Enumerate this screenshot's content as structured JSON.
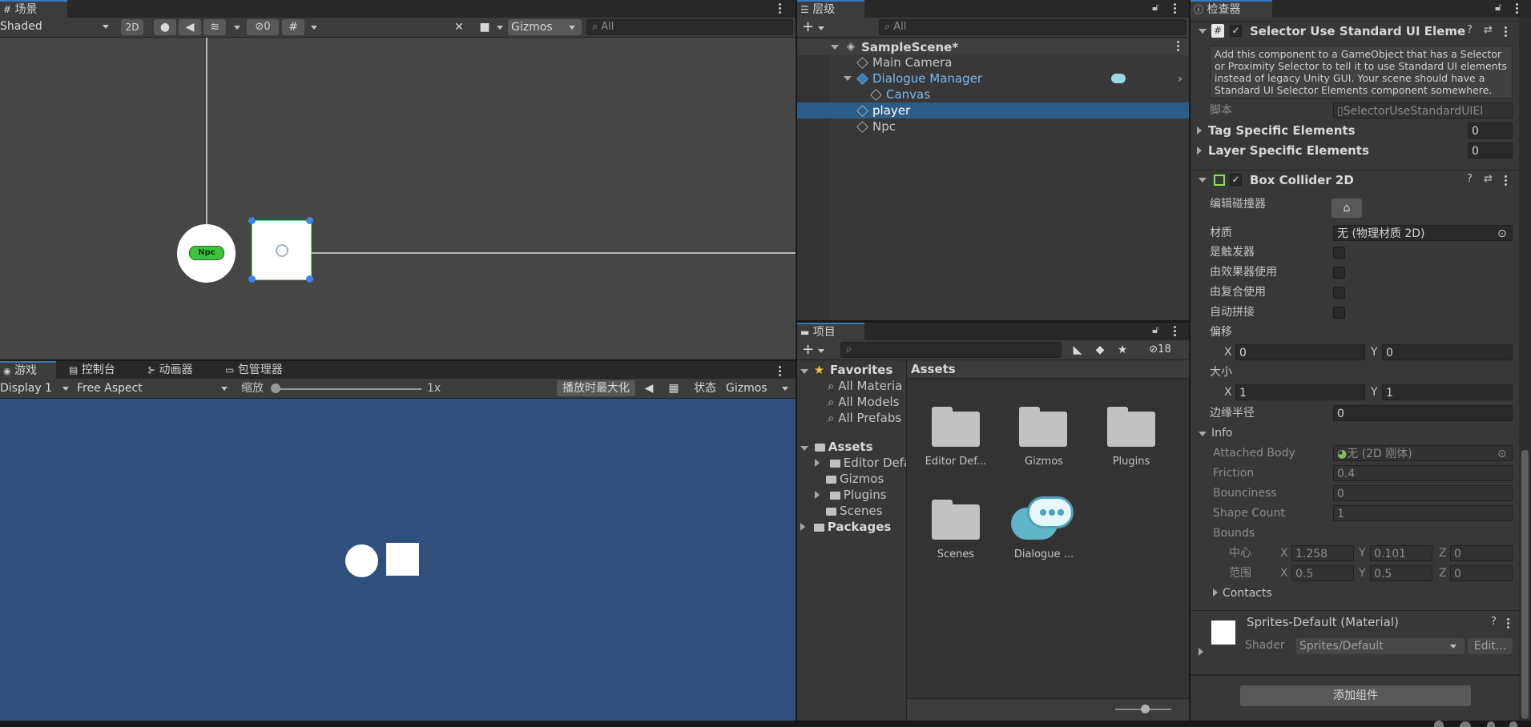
{
  "scene": {
    "tab": "场景",
    "shading": "Shaded",
    "mode2d": "2D",
    "hidden_count": "0",
    "gizmos": "Gizmos",
    "search_placeholder": "All",
    "npc_label": "Npc"
  },
  "game": {
    "tabs": [
      "游戏",
      "控制台",
      "动画器",
      "包管理器"
    ],
    "display": "Display 1",
    "aspect": "Free Aspect",
    "scale_label": "缩放",
    "scale_value": "1x",
    "maximize": "播放时最大化",
    "stats": "状态",
    "gizmos": "Gizmos",
    "background": "#2f4f7c"
  },
  "hierarchy": {
    "tab": "层级",
    "search_placeholder": "All",
    "scene_name": "SampleScene*",
    "items": [
      "Main Camera",
      "Dialogue Manager",
      "Canvas",
      "player",
      "Npc"
    ]
  },
  "project": {
    "tab": "项目",
    "badge_count": "18",
    "favorites": "Favorites",
    "fav_items": [
      "All Materia",
      "All Models",
      "All Prefabs"
    ],
    "assets_root": "Assets",
    "asset_folders": [
      "Editor Defa",
      "Gizmos",
      "Plugins",
      "Scenes"
    ],
    "packages": "Packages",
    "breadcrumb": "Assets",
    "grid": [
      "Editor Def...",
      "Gizmos",
      "Plugins",
      "Scenes",
      "Dialogue ..."
    ]
  },
  "inspector": {
    "tab": "检查器",
    "comp1_title": "Selector Use Standard UI Element",
    "comp1_help": "Add this component to a GameObject that has a Selector or Proximity Selector to tell it to use Standard UI elements instead of legacy Unity GUI. Your scene should have a Standard UI Selector Elements component somewhere.",
    "script_label": "脚本",
    "script_value": "SelectorUseStandardUIEl",
    "tag_label": "Tag Specific Elements",
    "tag_value": "0",
    "layer_label": "Layer Specific Elements",
    "layer_value": "0",
    "comp2_title": "Box Collider 2D",
    "edit_collider": "编辑碰撞器",
    "material_label": "材质",
    "material_value": "无 (物理材质 2D)",
    "is_trigger": "是触发器",
    "used_by_effector": "由效果器使用",
    "used_by_composite": "由复合使用",
    "auto_tiling": "自动拼接",
    "offset_label": "偏移",
    "offset_x": "0",
    "offset_y": "0",
    "size_label": "大小",
    "size_x": "1",
    "size_y": "1",
    "edge_radius_label": "边缘半径",
    "edge_radius": "0",
    "info_label": "Info",
    "attached_body_label": "Attached Body",
    "attached_body_value": "无 (2D 刚体)",
    "friction_label": "Friction",
    "friction": "0.4",
    "bounciness_label": "Bounciness",
    "bounciness": "0",
    "shape_count_label": "Shape Count",
    "shape_count": "1",
    "bounds_label": "Bounds",
    "center_label": "中心",
    "center_x": "1.258",
    "center_y": "0.101",
    "center_z": "0",
    "extent_label": "范围",
    "extent_x": "0.5",
    "extent_y": "0.5",
    "extent_z": "0",
    "contacts_label": "Contacts",
    "material_name": "Sprites-Default (Material)",
    "shader_label": "Shader",
    "shader_value": "Sprites/Default",
    "edit_label": "Edit...",
    "add_component": "添加组件",
    "axis_x": "X",
    "axis_y": "Y",
    "axis_z": "Z"
  },
  "colors": {
    "accent": "#3a79bb",
    "selection": "#2c5d87",
    "npc_green": "#3cc23c"
  }
}
